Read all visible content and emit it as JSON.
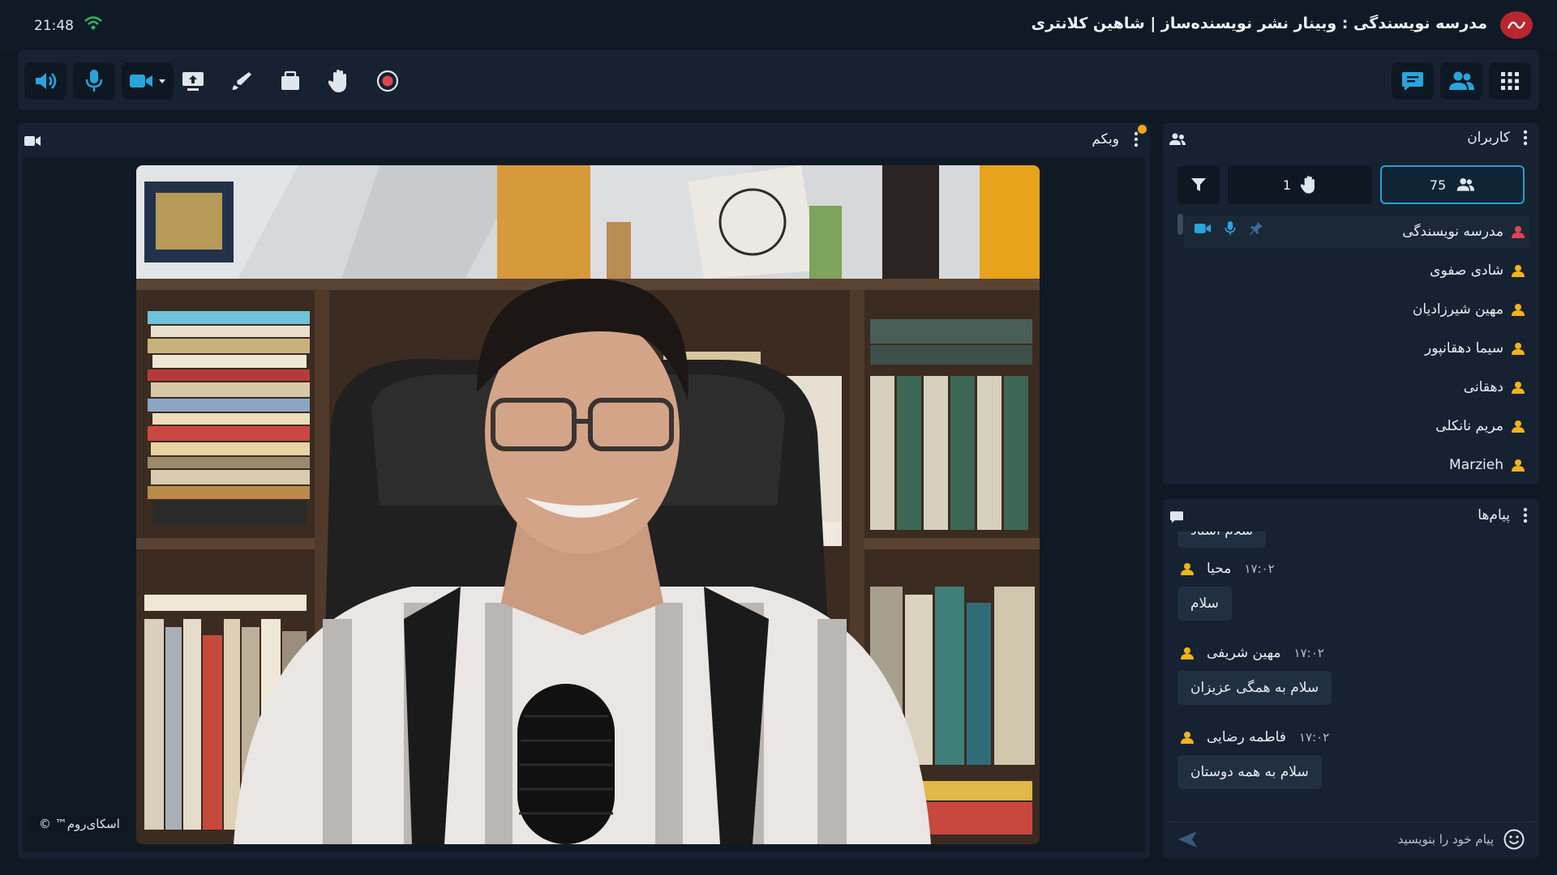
{
  "status": {
    "time": "21:48"
  },
  "app": {
    "title": "مدرسه نویسندگی : وبینار نشر نویسنده‌ساز | شاهین کلانتری"
  },
  "toolbar": {
    "left_icons": [
      "speaker-icon",
      "microphone-icon",
      "camera-icon",
      "share-screen-icon",
      "whiteboard-pen-icon",
      "files-icon",
      "raise-hand-icon",
      "record-icon"
    ],
    "right_icons": [
      "chat-icon",
      "users-icon",
      "apps-grid-icon"
    ]
  },
  "webcam": {
    "title": "وبکم",
    "watermark": "اسکای‌روم™ ©"
  },
  "users": {
    "title": "کاربران",
    "count_label": "75",
    "hands_label": "1",
    "list": [
      {
        "name": "مدرسه نویسندگی",
        "role": "presenter"
      },
      {
        "name": "شادی صفوی",
        "role": "member"
      },
      {
        "name": "مهین شیرزادیان",
        "role": "member"
      },
      {
        "name": "سیما دهقانپور",
        "role": "member"
      },
      {
        "name": "دهقانی",
        "role": "member"
      },
      {
        "name": "مریم نانکلی",
        "role": "member"
      },
      {
        "name": "Marzieh",
        "role": "member"
      }
    ]
  },
  "messages": {
    "title": "پیام‌ها",
    "partial_text": "سلام استاد",
    "items": [
      {
        "author": "محیا",
        "time": "۱۷:۰۲",
        "text": "سلام"
      },
      {
        "author": "مهین شریفی",
        "time": "۱۷:۰۲",
        "text": "سلام به همگی عزیزان"
      },
      {
        "author": "فاطمه رضایی",
        "time": "۱۷:۰۲",
        "text": "سلام به همه دوستان"
      }
    ],
    "compose_placeholder": "پیام خود را بنویسید"
  },
  "colors": {
    "accent": "#2a9fd0",
    "presenter": "#e0454f",
    "member": "#f2b41c",
    "bg": "#0f1823",
    "panel": "#162231"
  }
}
